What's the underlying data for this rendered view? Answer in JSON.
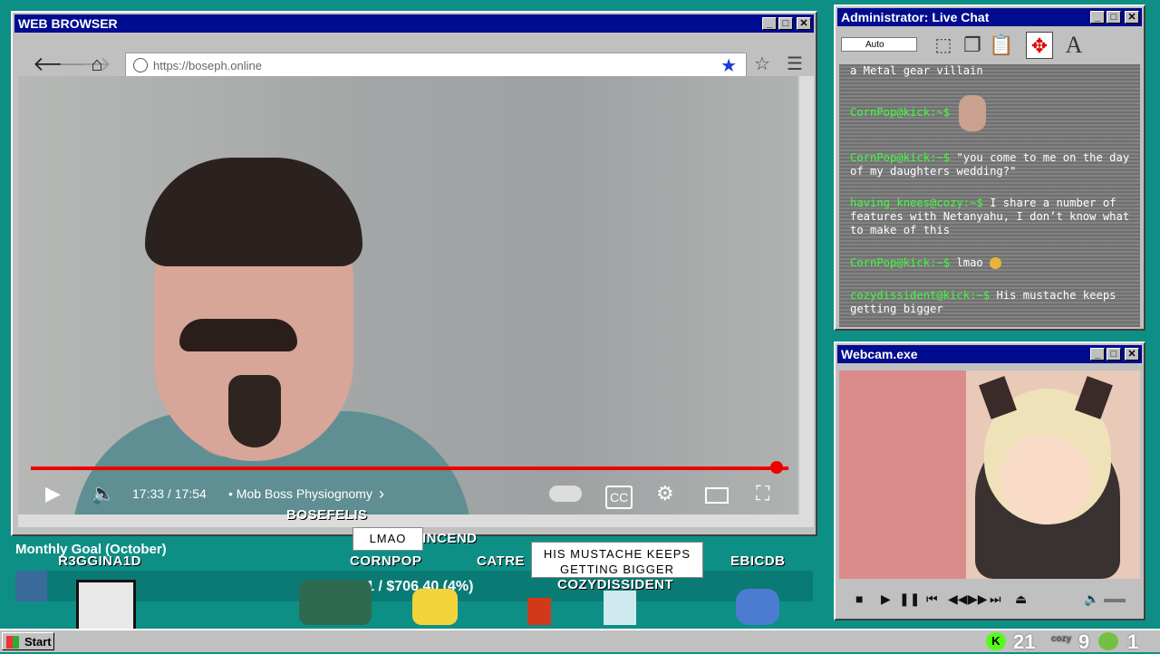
{
  "browser": {
    "title": "WEB BROWSER",
    "url": "https://boseph.online",
    "video": {
      "time": "17:33 / 17:54",
      "chapter": "• Mob Boss Physiognomy",
      "progress": 0.98
    }
  },
  "overlay": {
    "goal_title": "Monthly Goal (October)",
    "goal_amount": "$31.1 / $706.40 (4%)",
    "goal_progress": 0.04,
    "users": [
      "BOSEFELIS",
      "INCEND",
      "R3GGINA1D",
      "CORNPOP",
      "CATRE",
      "COZYDISSIDENT",
      "EBICDB"
    ],
    "bubble_small": "LMAO",
    "bubble_big": "HIS MUSTACHE KEEPS GETTING BIGGER"
  },
  "chat": {
    "title": "Administrator: Live Chat",
    "select_value": "Auto",
    "messages": [
      {
        "user": "",
        "text": "a Metal gear villain"
      },
      {
        "user": "CornPop@kick:~$",
        "text": ""
      },
      {
        "user": "CornPop@kick:~$",
        "text": "\"you come to me on the day of my daughters wedding?\""
      },
      {
        "user": "having_knees@cozy:~$",
        "text": "I share a number of features with Netanyahu, I don’t know what to make of this"
      },
      {
        "user": "CornPop@kick:~$",
        "text": "lmao"
      },
      {
        "user": "cozydissident@kick:~$",
        "text": "His mustache keeps getting bigger"
      }
    ]
  },
  "webcam": {
    "title": "Webcam.exe"
  },
  "taskbar": {
    "start": "Start",
    "kick_count": "21",
    "cozy_count": "9",
    "rumble_count": "1"
  }
}
